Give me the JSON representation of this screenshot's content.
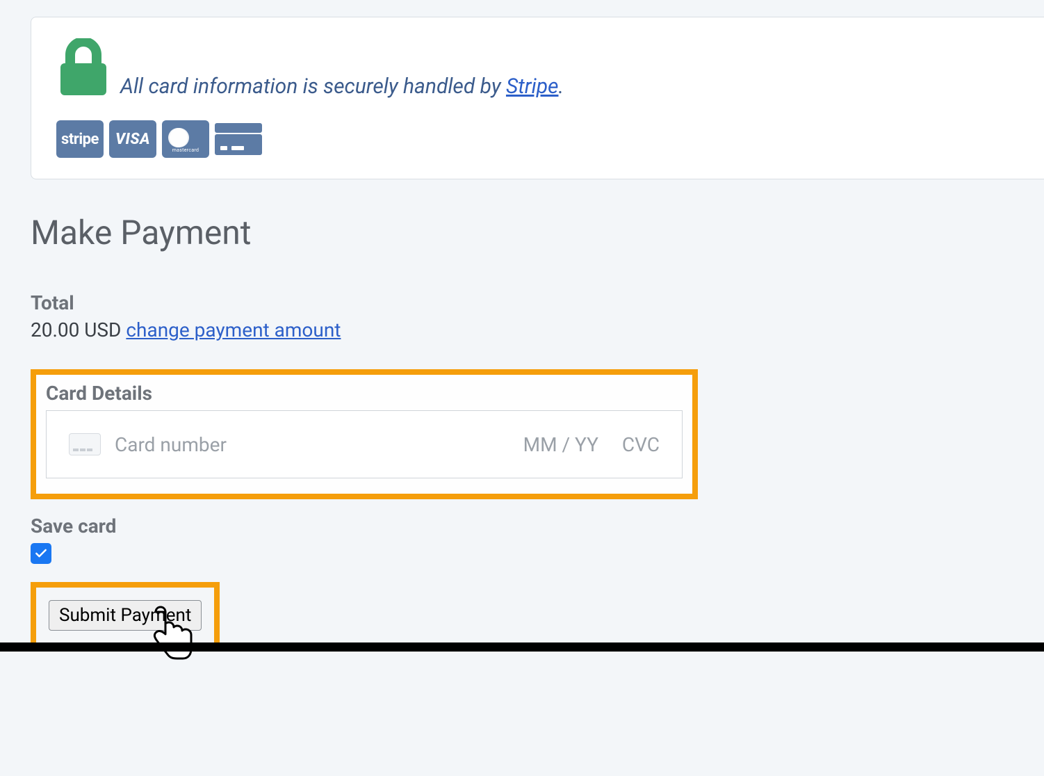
{
  "security": {
    "message_prefix": "All card information is securely handled by ",
    "provider_link_text": "Stripe",
    "message_suffix": ".",
    "badges": {
      "stripe": "stripe",
      "visa": "VISA",
      "mastercard": "mastercard"
    }
  },
  "heading": "Make Payment",
  "total": {
    "label": "Total",
    "amount": "20.00 USD",
    "change_link": "change payment amount"
  },
  "card_details": {
    "label": "Card Details",
    "placeholder_number": "Card number",
    "placeholder_expiry": "MM / YY",
    "placeholder_cvc": "CVC"
  },
  "save_card": {
    "label": "Save card",
    "checked": true
  },
  "submit": {
    "label": "Submit Payment"
  },
  "colors": {
    "highlight": "#f59e0b",
    "link": "#2c5fc9",
    "badge_bg": "#5c7ba5",
    "lock": "#3fa66a"
  }
}
